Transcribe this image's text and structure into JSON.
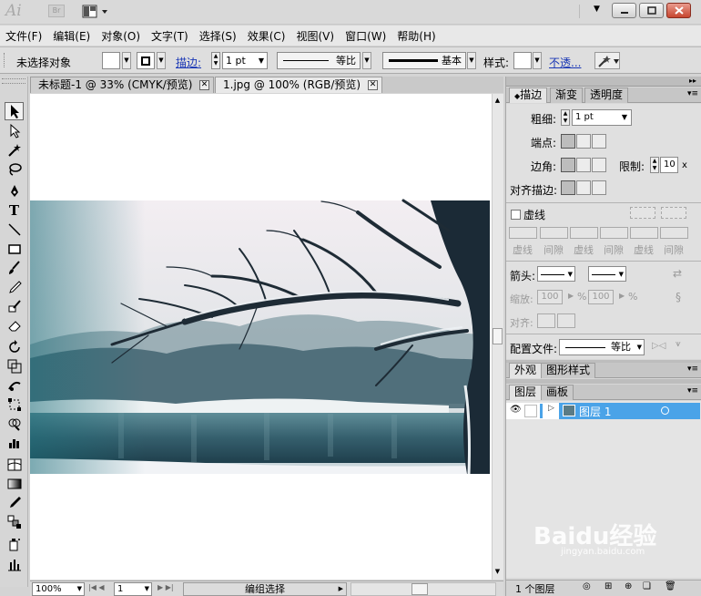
{
  "app": {
    "logo": "Ai",
    "bridge": "Br"
  },
  "menu": [
    "文件(F)",
    "编辑(E)",
    "对象(O)",
    "文字(T)",
    "选择(S)",
    "效果(C)",
    "视图(V)",
    "窗口(W)",
    "帮助(H)"
  ],
  "control": {
    "no_selection": "未选择对象",
    "stroke_label": "描边:",
    "stroke_weight": "1 pt",
    "profile": "等比",
    "brush": "基本",
    "style_label": "样式:",
    "opacity": "不透..."
  },
  "tabs": [
    {
      "label": "未标题-1 @ 33% (CMYK/预览)",
      "close": "✕"
    },
    {
      "label": "1.jpg @ 100% (RGB/预览)",
      "close": "✕"
    }
  ],
  "status": {
    "zoom": "100%",
    "page": "1",
    "mode": "编组选择"
  },
  "stroke_panel": {
    "tabs": [
      "描边",
      "渐变",
      "透明度"
    ],
    "weight_label": "粗细:",
    "weight_value": "1 pt",
    "cap_label": "端点:",
    "corner_label": "边角:",
    "limit_label": "限制:",
    "limit_value": "10",
    "limit_unit": "x",
    "align_label": "对齐描边:",
    "dashed_label": "虚线",
    "dash_labels": [
      "虚线",
      "间隙",
      "虚线",
      "间隙",
      "虚线",
      "间隙"
    ],
    "arrow_label": "箭头:",
    "scale_label": "缩放:",
    "scale_a": "100",
    "scale_b": "100",
    "pct": "%",
    "align2_label": "对齐:",
    "profile_label": "配置文件:",
    "profile_value": "等比"
  },
  "appearance_panel": {
    "tabs": [
      "外观",
      "图形样式"
    ]
  },
  "layers_panel": {
    "tabs": [
      "图层",
      "画板"
    ],
    "layer_name": "图层 1",
    "count": "1 个图层",
    "accent": "#4aa3e8"
  },
  "watermark": {
    "brand": "Baidu经验",
    "url": "jingyan.baidu.com"
  }
}
